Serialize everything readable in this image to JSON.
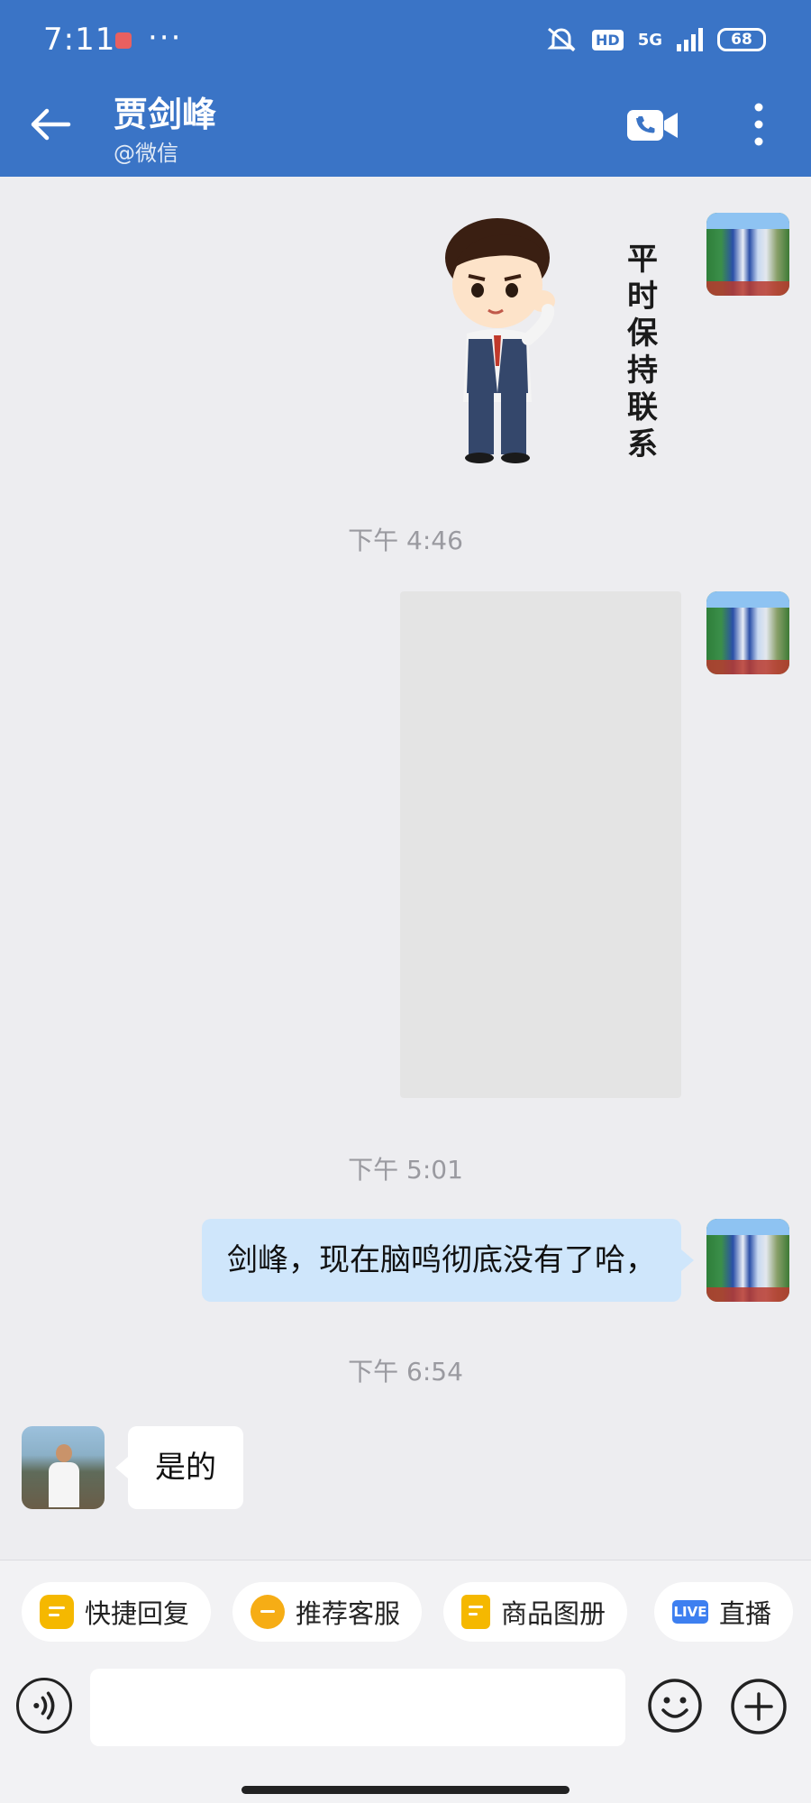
{
  "status": {
    "time": "7:11",
    "dots": "···",
    "network": "5G",
    "hd": "HD",
    "battery": "68"
  },
  "header": {
    "title": "贾剑峰",
    "subtitle": "@微信"
  },
  "messages": {
    "sticker_text": "平时保持联系",
    "ts1": "下午 4:46",
    "ts2": "下午 5:01",
    "out_text": "剑峰，现在脑鸣彻底没有了哈，",
    "ts3": "下午 6:54",
    "in_text": "是的"
  },
  "quick_replies": [
    {
      "label": "快捷回复",
      "icon": "quick-reply-icon"
    },
    {
      "label": "推荐客服",
      "icon": "recommend-service-icon"
    },
    {
      "label": "商品图册",
      "icon": "product-album-icon"
    },
    {
      "label": "直播",
      "icon": "live-icon",
      "badge": "LIVE"
    }
  ],
  "colors": {
    "header": "#3a74c6",
    "bubble_out": "#cfe6fb",
    "bubble_in": "#ffffff",
    "background": "#ededf0"
  }
}
